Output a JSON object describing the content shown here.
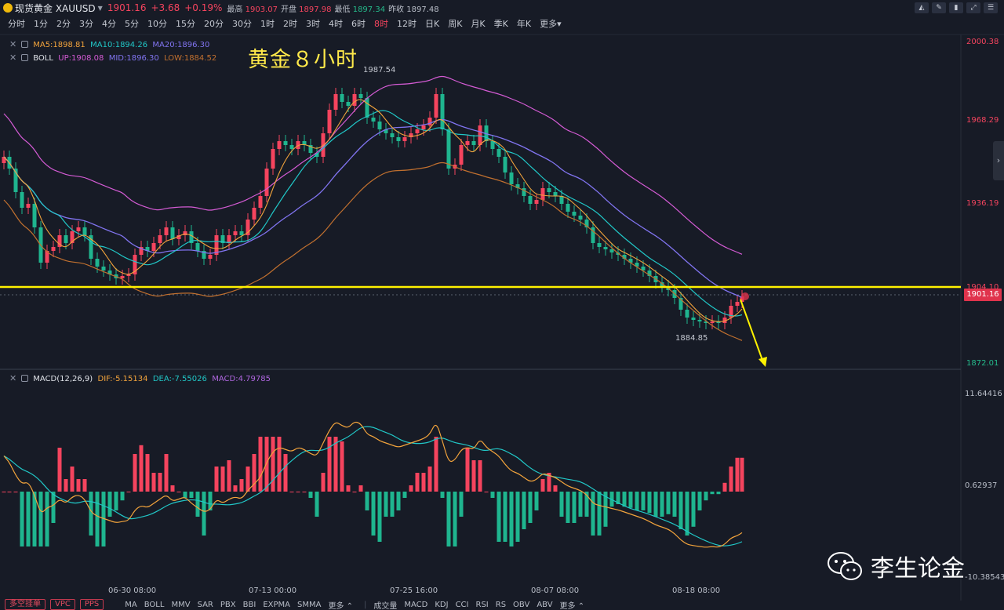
{
  "header": {
    "symbol_name": "现货黄金 XAUUSD",
    "price": "1901.16",
    "change": "+3.68",
    "change_pct": "+0.19%",
    "high_label": "最高",
    "high": "1903.07",
    "open_label": "开盘",
    "open": "1897.98",
    "low_label": "最低",
    "low": "1897.34",
    "prev_label": "昨收",
    "prev": "1897.48"
  },
  "periods": [
    "分时",
    "1分",
    "2分",
    "3分",
    "4分",
    "5分",
    "10分",
    "15分",
    "20分",
    "30分",
    "1时",
    "2时",
    "3时",
    "4时",
    "6时",
    "8时",
    "12时",
    "日K",
    "周K",
    "月K",
    "季K",
    "年K",
    "更多"
  ],
  "active_period": "8时",
  "indicators": {
    "ma": {
      "ma5": "MA5:1898.81",
      "ma10": "MA10:1894.26",
      "ma20": "MA20:1896.30"
    },
    "boll": {
      "name": "BOLL",
      "up": "UP:1908.08",
      "mid": "MID:1896.30",
      "low": "LOW:1884.52"
    },
    "macd": {
      "name": "MACD(12,26,9)",
      "dif": "DIF:-5.15134",
      "dea": "DEA:-7.55026",
      "macd": "MACD:4.79785"
    }
  },
  "headline": "黄金８小时",
  "annotations": {
    "high": "1987.54",
    "low": "1884.85"
  },
  "price_axis": [
    "2000.38",
    "1968.29",
    "1936.19",
    "1904.10",
    "1872.01"
  ],
  "macd_axis": [
    "11.64416",
    "0.62937",
    "-10.38543"
  ],
  "current_price_tag": "1901.16",
  "time_axis": [
    "06-30 08:00",
    "07-13 00:00",
    "07-25 16:00",
    "08-07 08:00",
    "08-18 08:00"
  ],
  "bottom": {
    "buttons": [
      "多空挂单",
      "VPC",
      "PPS"
    ],
    "main_indicators": [
      "MA",
      "BOLL",
      "MMV",
      "SAR",
      "PBX",
      "BBI",
      "EXPMA",
      "SMMA",
      "更多"
    ],
    "sub_indicators": [
      "成交量",
      "MACD",
      "KDJ",
      "CCI",
      "RSI",
      "RS",
      "OBV",
      "ABV",
      "更多"
    ]
  },
  "watermark": "李生论金",
  "colors": {
    "up": "#f5445e",
    "down": "#1fb58f",
    "ma5": "#f3a43c",
    "ma10": "#21c7c7",
    "ma20": "#8174f0",
    "boll_up": "#d45bd4",
    "boll_low": "#c1702f",
    "support_line": "#fff200",
    "arrow": "#fff200"
  }
}
